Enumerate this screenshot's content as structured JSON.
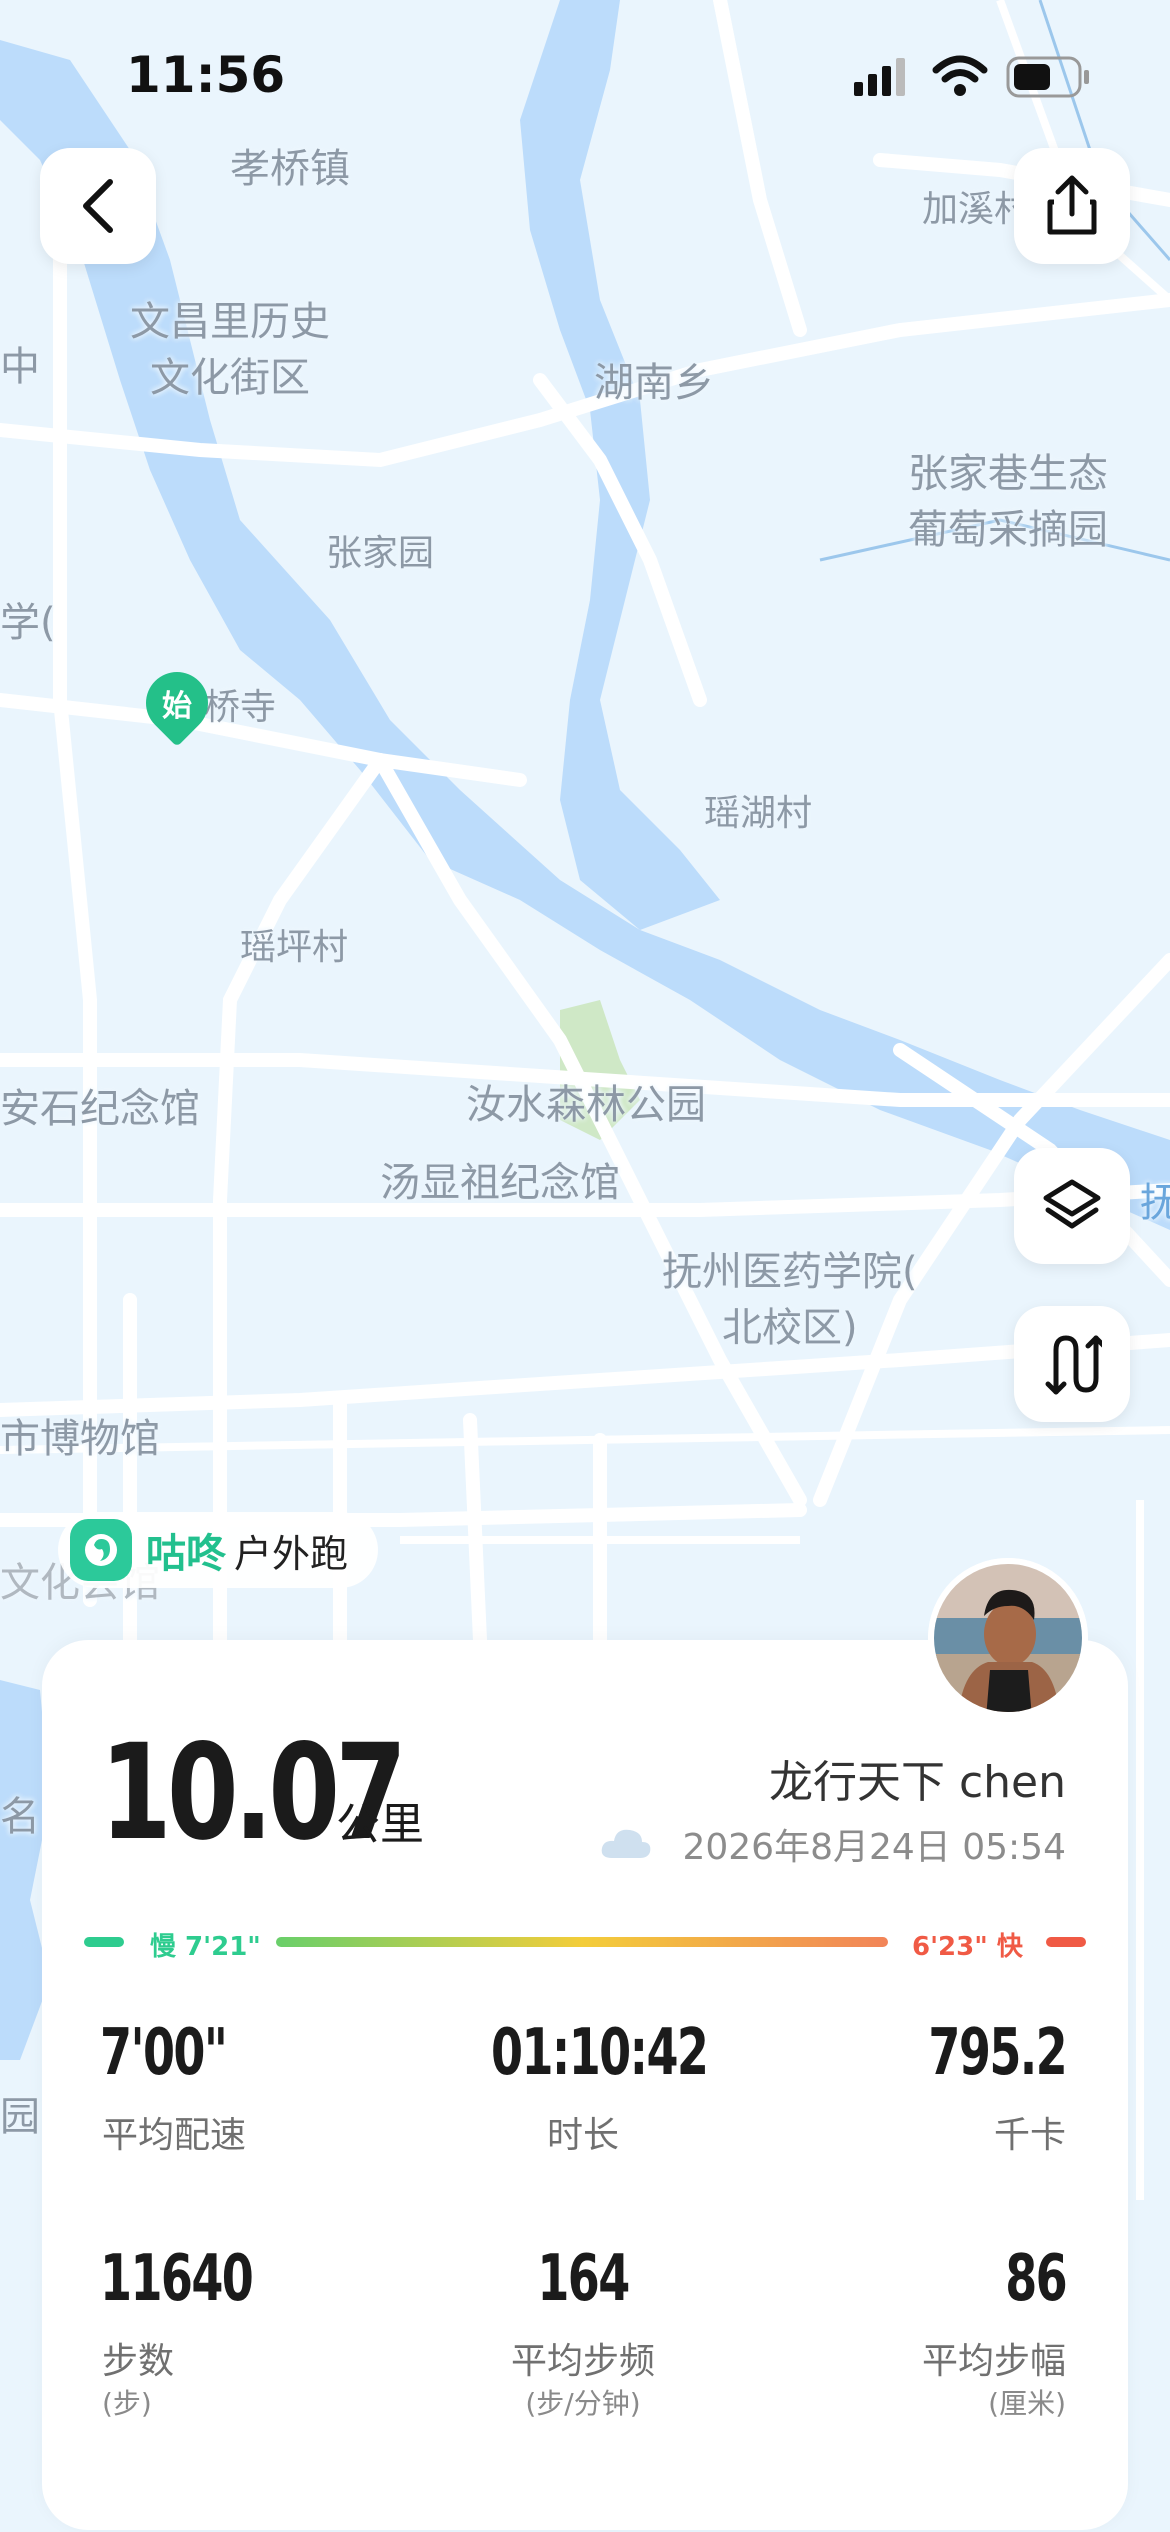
{
  "status_bar": {
    "time": "11:56"
  },
  "map": {
    "labels": [
      "孝桥镇",
      "文昌里历史\n文化街区",
      "湖南乡",
      "加溪村",
      "张家巷生态\n葡萄采摘园",
      "张家园",
      "桥寺",
      "瑶湖村",
      "瑶坪村",
      "汝水森林公园",
      "汤显祖纪念馆",
      "安石纪念馆",
      "抚州医药学院(\n北校区)",
      "市博物馆",
      "文化会馆",
      "中",
      "学(",
      "名",
      "园",
      "抚"
    ],
    "start_marker": "始"
  },
  "brand": {
    "name": "咕咚",
    "activity": "户外跑"
  },
  "summary": {
    "distance": "10.07",
    "distance_unit": "公里",
    "username": "龙行天下 chen",
    "datetime": "2026年8月24日 05:54",
    "pace_slow": "慢 7'21\"",
    "pace_fast": "6'23\" 快"
  },
  "stats": {
    "avg_pace": {
      "value": "7'00\"",
      "label": "平均配速"
    },
    "duration": {
      "value": "01:10:42",
      "label": "时长"
    },
    "calories": {
      "value": "795.2",
      "label": "千卡"
    },
    "steps": {
      "value": "11640",
      "label": "步数",
      "unit": "(步)"
    },
    "cadence": {
      "value": "164",
      "label": "平均步频",
      "unit": "(步/分钟)"
    },
    "stride": {
      "value": "86",
      "label": "平均步幅",
      "unit": "(厘米)"
    }
  },
  "colors": {
    "accent": "#22c08e",
    "slow": "#2ecc8f",
    "fast": "#f05a45",
    "water": "#bcdcfb",
    "land": "#eaf5fd"
  }
}
